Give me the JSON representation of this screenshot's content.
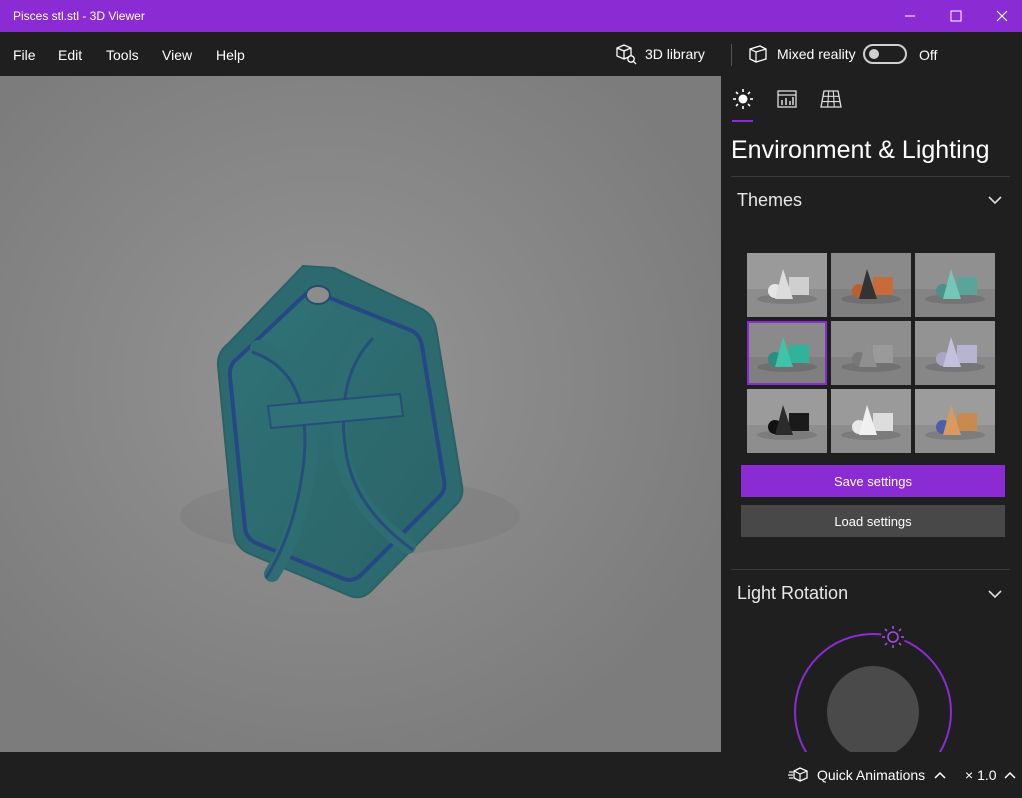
{
  "window": {
    "title": "Pisces stl.stl - 3D Viewer"
  },
  "menu": {
    "items": [
      "File",
      "Edit",
      "Tools",
      "View",
      "Help"
    ]
  },
  "toolbar": {
    "library_label": "3D library",
    "mixed_reality_label": "Mixed reality",
    "mixed_reality_state": "Off"
  },
  "panel": {
    "tabs": [
      "lighting-tab",
      "stats-tab",
      "grid-tab"
    ],
    "active_tab": "lighting-tab",
    "title": "Environment & Lighting",
    "themes_label": "Themes",
    "themes": [
      {
        "name": "theme-1",
        "bg": "#9a9a9a",
        "colors": [
          "#e6e6e6",
          "#dcdcdc",
          "#cfcfcf"
        ]
      },
      {
        "name": "theme-2",
        "bg": "#8a8a8a",
        "colors": [
          "#b8602f",
          "#333333",
          "#c76b3a"
        ]
      },
      {
        "name": "theme-3",
        "bg": "#909090",
        "colors": [
          "#4f8f87",
          "#74c6b8",
          "#5aa49a"
        ]
      },
      {
        "name": "theme-4",
        "bg": "#8a8a8a",
        "colors": [
          "#2a8f80",
          "#3fc4aa",
          "#30b39b"
        ],
        "selected": true
      },
      {
        "name": "theme-5",
        "bg": "#8e8e8e",
        "colors": [
          "#787878",
          "#8f8f8f",
          "#9a9a9a"
        ]
      },
      {
        "name": "theme-6",
        "bg": "#939393",
        "colors": [
          "#a9a6c4",
          "#c2c0dc",
          "#b6b4d0"
        ]
      },
      {
        "name": "theme-7",
        "bg": "#9b9b9b",
        "colors": [
          "#111111",
          "#2b2b2b",
          "#1a1a1a"
        ]
      },
      {
        "name": "theme-8",
        "bg": "#9a9a9a",
        "colors": [
          "#e8e8e8",
          "#f0f0f0",
          "#dddddd"
        ]
      },
      {
        "name": "theme-9",
        "bg": "#9c9c9c",
        "colors": [
          "#4d5fa8",
          "#d99a5f",
          "#c98a50"
        ]
      }
    ],
    "save_label": "Save settings",
    "load_label": "Load settings",
    "light_rotation_label": "Light Rotation"
  },
  "statusbar": {
    "quick_animations_label": "Quick Animations",
    "speed_label": "× 1.0"
  },
  "colors": {
    "accent": "#8a2bd4",
    "model": "#2d6c72"
  }
}
